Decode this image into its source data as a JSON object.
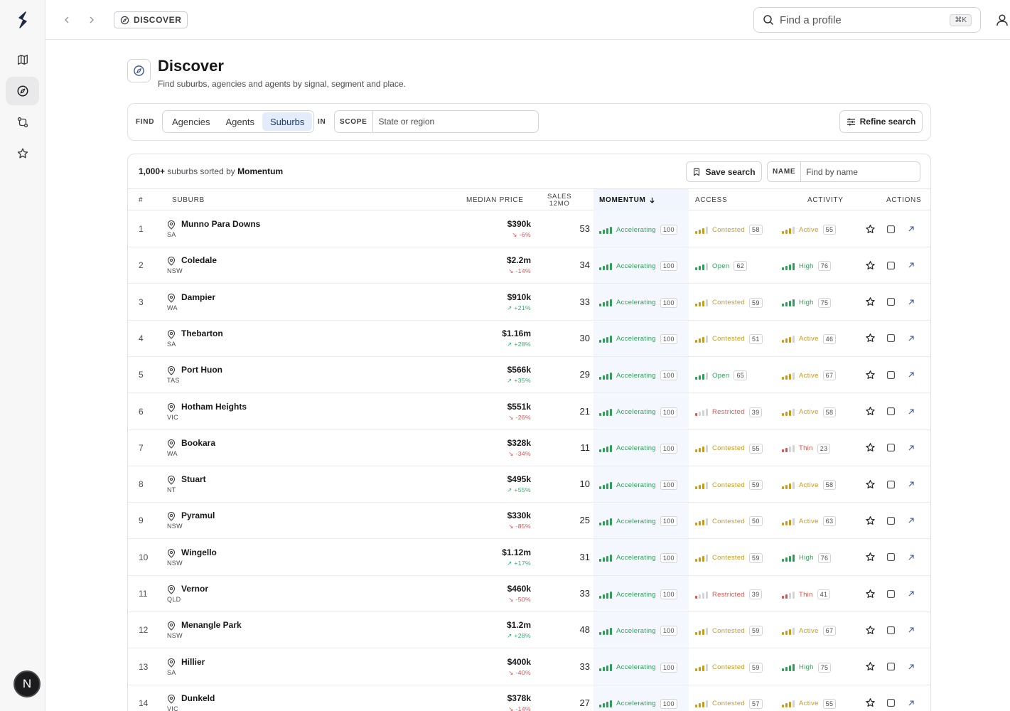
{
  "breadcrumb": {
    "label": "DISCOVER"
  },
  "top_search": {
    "placeholder": "Find a profile",
    "shortcut": "⌘K"
  },
  "sidebar": {
    "items": [
      {
        "name": "map-icon",
        "active": false
      },
      {
        "name": "compass-icon",
        "active": true
      },
      {
        "name": "compare-icon",
        "active": false
      },
      {
        "name": "star-icon",
        "active": false
      }
    ],
    "avatar_initial": "N"
  },
  "header": {
    "title": "Discover",
    "subtitle": "Find suburbs, agencies and agents by signal, segment and place."
  },
  "filters": {
    "find_label": "FIND",
    "options": [
      "Agencies",
      "Agents",
      "Suburbs"
    ],
    "selected": "Suburbs",
    "in_label": "IN",
    "scope_label": "SCOPE",
    "scope_placeholder": "State or region",
    "refine_label": "Refine search"
  },
  "results": {
    "count": "1,000+",
    "sorted_text": "suburbs sorted by",
    "sort_key": "Momentum",
    "save_label": "Save search",
    "name_label": "NAME",
    "name_placeholder": "Find by name"
  },
  "columns": {
    "rank": "#",
    "suburb": "SUBURB",
    "median_price": "MEDIAN PRICE",
    "sales_line1": "SALES",
    "sales_line2": "12MO",
    "momentum": "MOMENTUM",
    "access": "ACCESS",
    "activity": "ACTIVITY",
    "actions": "ACTIONS"
  },
  "colors": {
    "green": "#2f9e57",
    "amber": "#c99a1c",
    "red": "#d9534f",
    "accent_bg": "#e3ecfb"
  },
  "rows": [
    {
      "rank": "1",
      "suburb": "Munno Para Downs",
      "state": "SA",
      "price": "$390k",
      "delta": "-6%",
      "trend": "down",
      "sales": "53",
      "momentum": "Accelerating",
      "momentum_score": "100",
      "access": "Contested",
      "access_score": "58",
      "activity": "Active",
      "activity_score": "55"
    },
    {
      "rank": "2",
      "suburb": "Coledale",
      "state": "NSW",
      "price": "$2.2m",
      "delta": "-14%",
      "trend": "down",
      "sales": "34",
      "momentum": "Accelerating",
      "momentum_score": "100",
      "access": "Open",
      "access_score": "62",
      "activity": "High",
      "activity_score": "76"
    },
    {
      "rank": "3",
      "suburb": "Dampier",
      "state": "WA",
      "price": "$910k",
      "delta": "+21%",
      "trend": "up",
      "sales": "33",
      "momentum": "Accelerating",
      "momentum_score": "100",
      "access": "Contested",
      "access_score": "59",
      "activity": "High",
      "activity_score": "75"
    },
    {
      "rank": "4",
      "suburb": "Thebarton",
      "state": "SA",
      "price": "$1.16m",
      "delta": "+28%",
      "trend": "up",
      "sales": "30",
      "momentum": "Accelerating",
      "momentum_score": "100",
      "access": "Contested",
      "access_score": "51",
      "activity": "Active",
      "activity_score": "46"
    },
    {
      "rank": "5",
      "suburb": "Port Huon",
      "state": "TAS",
      "price": "$566k",
      "delta": "+35%",
      "trend": "up",
      "sales": "29",
      "momentum": "Accelerating",
      "momentum_score": "100",
      "access": "Open",
      "access_score": "65",
      "activity": "Active",
      "activity_score": "67"
    },
    {
      "rank": "6",
      "suburb": "Hotham Heights",
      "state": "VIC",
      "price": "$551k",
      "delta": "-26%",
      "trend": "down",
      "sales": "21",
      "momentum": "Accelerating",
      "momentum_score": "100",
      "access": "Restricted",
      "access_score": "39",
      "activity": "Active",
      "activity_score": "58"
    },
    {
      "rank": "7",
      "suburb": "Bookara",
      "state": "WA",
      "price": "$328k",
      "delta": "-34%",
      "trend": "down",
      "sales": "11",
      "momentum": "Accelerating",
      "momentum_score": "100",
      "access": "Contested",
      "access_score": "55",
      "activity": "Thin",
      "activity_score": "23"
    },
    {
      "rank": "8",
      "suburb": "Stuart",
      "state": "NT",
      "price": "$495k",
      "delta": "+55%",
      "trend": "up",
      "sales": "10",
      "momentum": "Accelerating",
      "momentum_score": "100",
      "access": "Contested",
      "access_score": "59",
      "activity": "Active",
      "activity_score": "58"
    },
    {
      "rank": "9",
      "suburb": "Pyramul",
      "state": "NSW",
      "price": "$330k",
      "delta": "-85%",
      "trend": "down",
      "sales": "25",
      "momentum": "Accelerating",
      "momentum_score": "100",
      "access": "Contested",
      "access_score": "50",
      "activity": "Active",
      "activity_score": "63"
    },
    {
      "rank": "10",
      "suburb": "Wingello",
      "state": "NSW",
      "price": "$1.12m",
      "delta": "+17%",
      "trend": "up",
      "sales": "31",
      "momentum": "Accelerating",
      "momentum_score": "100",
      "access": "Contested",
      "access_score": "59",
      "activity": "High",
      "activity_score": "76"
    },
    {
      "rank": "11",
      "suburb": "Vernor",
      "state": "QLD",
      "price": "$460k",
      "delta": "-50%",
      "trend": "down",
      "sales": "33",
      "momentum": "Accelerating",
      "momentum_score": "100",
      "access": "Restricted",
      "access_score": "39",
      "activity": "Thin",
      "activity_score": "41"
    },
    {
      "rank": "12",
      "suburb": "Menangle Park",
      "state": "NSW",
      "price": "$1.2m",
      "delta": "+28%",
      "trend": "up",
      "sales": "48",
      "momentum": "Accelerating",
      "momentum_score": "100",
      "access": "Contested",
      "access_score": "59",
      "activity": "Active",
      "activity_score": "67"
    },
    {
      "rank": "13",
      "suburb": "Hillier",
      "state": "SA",
      "price": "$400k",
      "delta": "-40%",
      "trend": "down",
      "sales": "33",
      "momentum": "Accelerating",
      "momentum_score": "100",
      "access": "Contested",
      "access_score": "59",
      "activity": "High",
      "activity_score": "75"
    },
    {
      "rank": "14",
      "suburb": "Dunkeld",
      "state": "VIC",
      "price": "$378k",
      "delta": "-14%",
      "trend": "down",
      "sales": "27",
      "momentum": "Accelerating",
      "momentum_score": "100",
      "access": "Contested",
      "access_score": "57",
      "activity": "Active",
      "activity_score": "55"
    }
  ]
}
